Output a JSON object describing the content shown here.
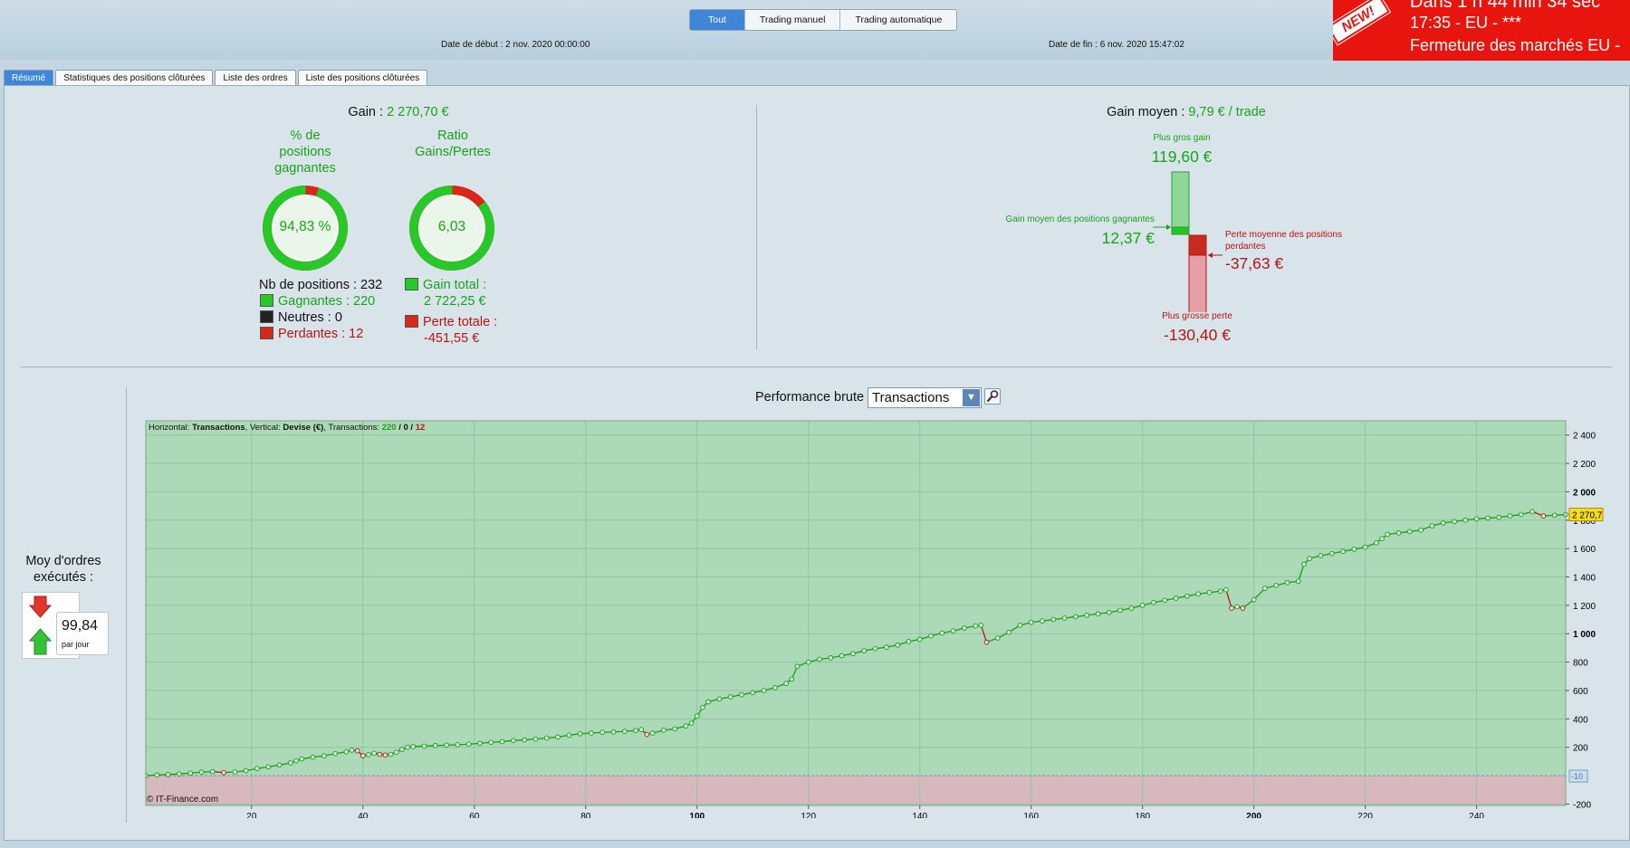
{
  "toolbar": {
    "filters": [
      "Tout",
      "Trading manuel",
      "Trading automatique"
    ],
    "start_date": "Date de début : 2 nov. 2020 00:00:00",
    "end_date": "Date de fin : 6 nov. 2020 15:47:02"
  },
  "promo": {
    "badge": "NEW!",
    "line1": "Dans 1 h 44 min 34 sec",
    "line2_time": "17:35",
    "line2_rest": " - EU - ***",
    "line3": "Fermeture des marchés EU -"
  },
  "tabs": [
    "Résumé",
    "Statistiques des positions clôturées",
    "Liste des ordres",
    "Liste des positions clôturées"
  ],
  "summary": {
    "gain_label": "Gain : ",
    "gain_value": "2 270,70 €",
    "win_pct_title_l1": "% de",
    "win_pct_title_l2": "positions",
    "win_pct_title_l3": "gagnantes",
    "win_pct_value": "94,83 %",
    "win_fraction": 0.9483,
    "ratio_title_l1": "Ratio",
    "ratio_title_l2": "Gains/Pertes",
    "ratio_value": "6,03",
    "ratio_gain_fraction": 0.8577,
    "nb_positions": "Nb de positions : 232",
    "winners": "Gagnantes : 220",
    "neutral": "Neutres : 0",
    "losers": "Perdantes : 12",
    "gain_total_label": "Gain total :",
    "gain_total_value": "2 722,25 €",
    "perte_totale_label": "Perte totale :",
    "perte_totale_value": "-451,55 €"
  },
  "avg": {
    "title_label": "Gain moyen : ",
    "title_value": "9,79 € / trade",
    "max_gain_label": "Plus gros gain",
    "max_gain_value": "119,60 €",
    "avg_win_label": "Gain moyen des positions gagnantes",
    "avg_win_value": "12,37 €",
    "avg_loss_label_l1": "Perte moyenne des positions",
    "avg_loss_label_l2": "perdantes",
    "avg_loss_value": "-37,63 €",
    "max_loss_label": "Plus grosse perte",
    "max_loss_value": "-130,40 €"
  },
  "orders": {
    "title_l1": "Moy d'ordres",
    "title_l2": "exécutés :",
    "value": "99,84",
    "unit": "par jour"
  },
  "perf": {
    "title": "Performance brute",
    "mode": "Transactions"
  },
  "chart_data": {
    "type": "line",
    "header": {
      "h_label": "Horizontal: ",
      "h_value": "Transactions",
      "v_label": ", Vertical: ",
      "v_value": "Devise (€)",
      "t_label": ", Transactions: ",
      "t_win": "220",
      "t_sep1": " / ",
      "t_neutral": "0",
      "t_sep2": " / ",
      "t_loss": "12"
    },
    "copyright": "© IT-Finance.com",
    "xlim": [
      1,
      256
    ],
    "ylim": [
      -210,
      2500
    ],
    "x_ticks": [
      20,
      40,
      60,
      80,
      100,
      120,
      140,
      160,
      180,
      200,
      220,
      240
    ],
    "x_tick_labels": [
      "20",
      "40",
      "60",
      "80",
      "100",
      "120",
      "140",
      "160",
      "180",
      "200",
      "220",
      "240"
    ],
    "y_ticks": [
      -200,
      200,
      400,
      600,
      800,
      1000,
      1200,
      1400,
      1600,
      1800,
      2000,
      2200,
      2400
    ],
    "y_tick_labels": [
      "-200",
      "200",
      "400",
      "600",
      "800",
      "1 000",
      "1 200",
      "1 400",
      "1 600",
      "1 800",
      "2 000",
      "2 200",
      "2 400"
    ],
    "last_value_label": "2 270,7",
    "zero_label": "-10",
    "colors": {
      "gain_area": "#acd9b8",
      "loss_area": "#d7b8bf",
      "line_up": "#1e9a1e",
      "line_down": "#b51515",
      "grid": "#93c6a3"
    },
    "series": [
      {
        "points": [
          [
            1,
            0
          ],
          [
            3,
            5
          ],
          [
            5,
            8
          ],
          [
            7,
            12
          ],
          [
            9,
            18
          ],
          [
            11,
            25
          ],
          [
            13,
            28
          ],
          [
            15,
            22
          ],
          [
            17,
            26
          ],
          [
            19,
            35
          ],
          [
            21,
            50
          ],
          [
            23,
            62
          ],
          [
            25,
            75
          ],
          [
            27,
            90
          ],
          [
            28,
            105
          ],
          [
            29,
            118
          ],
          [
            31,
            130
          ],
          [
            33,
            140
          ],
          [
            35,
            155
          ],
          [
            37,
            168
          ],
          [
            38,
            180
          ],
          [
            39,
            175
          ],
          [
            40,
            140
          ],
          [
            41,
            148
          ],
          [
            42,
            158
          ],
          [
            43,
            150
          ],
          [
            44,
            145
          ],
          [
            45,
            150
          ],
          [
            46,
            165
          ],
          [
            47,
            185
          ],
          [
            48,
            200
          ],
          [
            49,
            205
          ],
          [
            51,
            208
          ],
          [
            53,
            212
          ],
          [
            55,
            215
          ],
          [
            57,
            218
          ],
          [
            59,
            222
          ],
          [
            61,
            228
          ],
          [
            63,
            235
          ],
          [
            65,
            240
          ],
          [
            67,
            248
          ],
          [
            69,
            252
          ],
          [
            71,
            258
          ],
          [
            73,
            265
          ],
          [
            75,
            272
          ],
          [
            77,
            285
          ],
          [
            79,
            295
          ],
          [
            81,
            300
          ],
          [
            83,
            305
          ],
          [
            85,
            308
          ],
          [
            87,
            312
          ],
          [
            89,
            318
          ],
          [
            90,
            325
          ],
          [
            91,
            290
          ],
          [
            92,
            300
          ],
          [
            94,
            320
          ],
          [
            96,
            330
          ],
          [
            98,
            350
          ],
          [
            99,
            370
          ],
          [
            100,
            420
          ],
          [
            101,
            480
          ],
          [
            102,
            520
          ],
          [
            104,
            540
          ],
          [
            106,
            555
          ],
          [
            108,
            570
          ],
          [
            110,
            585
          ],
          [
            112,
            600
          ],
          [
            114,
            620
          ],
          [
            116,
            650
          ],
          [
            117,
            680
          ],
          [
            118,
            770
          ],
          [
            120,
            800
          ],
          [
            122,
            820
          ],
          [
            124,
            830
          ],
          [
            126,
            845
          ],
          [
            128,
            860
          ],
          [
            130,
            880
          ],
          [
            132,
            895
          ],
          [
            134,
            905
          ],
          [
            136,
            920
          ],
          [
            138,
            945
          ],
          [
            140,
            960
          ],
          [
            142,
            985
          ],
          [
            144,
            1005
          ],
          [
            146,
            1020
          ],
          [
            148,
            1040
          ],
          [
            150,
            1055
          ],
          [
            151,
            1060
          ],
          [
            152,
            940
          ],
          [
            154,
            970
          ],
          [
            156,
            1010
          ],
          [
            158,
            1060
          ],
          [
            160,
            1080
          ],
          [
            162,
            1090
          ],
          [
            164,
            1100
          ],
          [
            166,
            1110
          ],
          [
            168,
            1120
          ],
          [
            170,
            1130
          ],
          [
            172,
            1140
          ],
          [
            174,
            1150
          ],
          [
            176,
            1165
          ],
          [
            178,
            1180
          ],
          [
            180,
            1200
          ],
          [
            182,
            1220
          ],
          [
            184,
            1235
          ],
          [
            186,
            1250
          ],
          [
            188,
            1265
          ],
          [
            190,
            1280
          ],
          [
            192,
            1290
          ],
          [
            194,
            1300
          ],
          [
            195,
            1310
          ],
          [
            196,
            1180
          ],
          [
            197,
            1190
          ],
          [
            198,
            1180
          ],
          [
            200,
            1240
          ],
          [
            202,
            1320
          ],
          [
            204,
            1340
          ],
          [
            206,
            1360
          ],
          [
            208,
            1370
          ],
          [
            209,
            1490
          ],
          [
            210,
            1530
          ],
          [
            212,
            1550
          ],
          [
            214,
            1565
          ],
          [
            216,
            1580
          ],
          [
            218,
            1595
          ],
          [
            220,
            1610
          ],
          [
            222,
            1640
          ],
          [
            223,
            1670
          ],
          [
            224,
            1700
          ],
          [
            226,
            1710
          ],
          [
            228,
            1720
          ],
          [
            230,
            1730
          ],
          [
            232,
            1760
          ],
          [
            234,
            1780
          ],
          [
            236,
            1790
          ],
          [
            238,
            1800
          ],
          [
            240,
            1810
          ],
          [
            242,
            1815
          ],
          [
            244,
            1820
          ],
          [
            246,
            1830
          ],
          [
            248,
            1840
          ],
          [
            250,
            1860
          ],
          [
            252,
            1830
          ],
          [
            254,
            1835
          ],
          [
            256,
            1840
          ]
        ]
      }
    ]
  }
}
